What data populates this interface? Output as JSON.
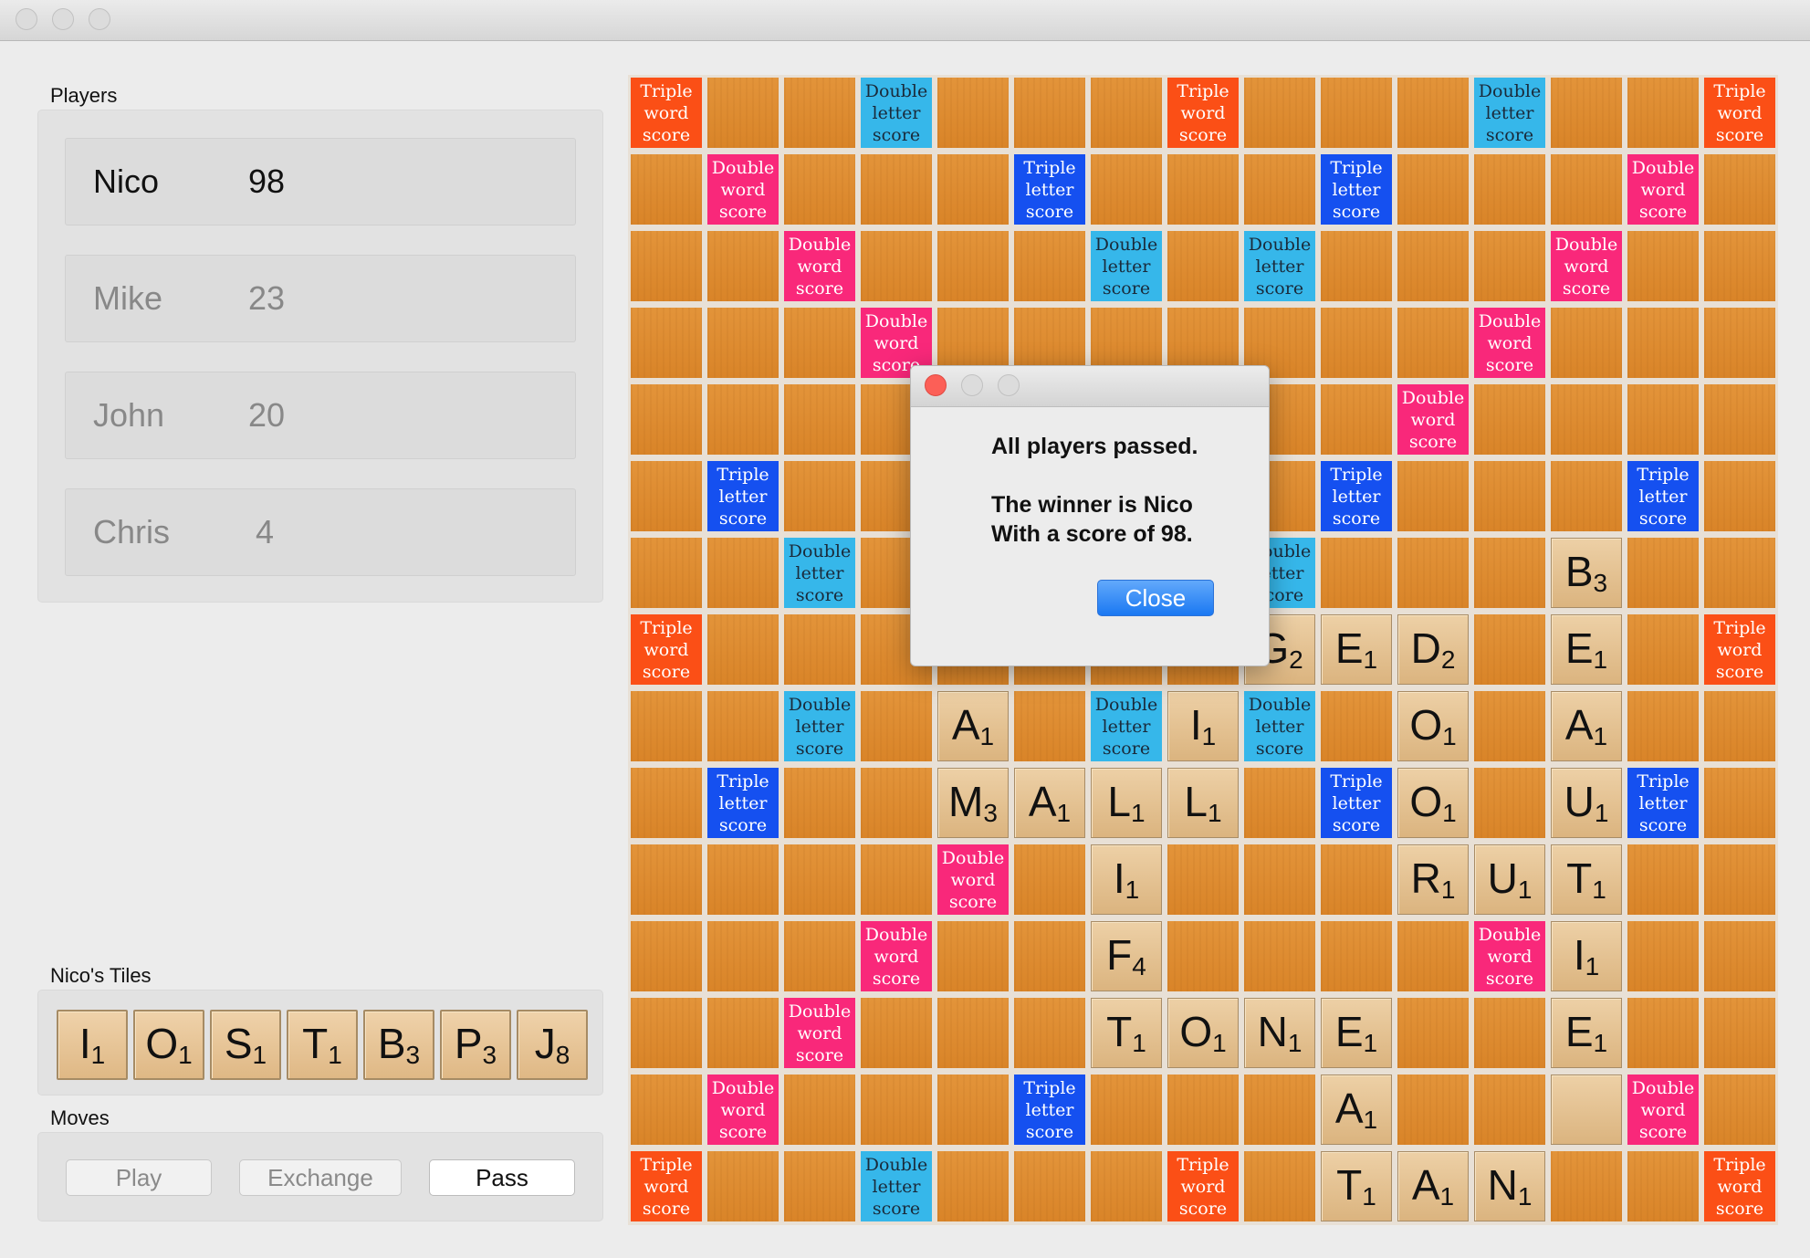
{
  "players_label": "Players",
  "players": [
    {
      "name": "Nico",
      "score": "98",
      "active": true
    },
    {
      "name": "Mike",
      "score": "23",
      "active": false
    },
    {
      "name": "John",
      "score": "20",
      "active": false
    },
    {
      "name": "Chris",
      "score": "4",
      "active": false
    }
  ],
  "rack_label": "Nico's Tiles",
  "rack": [
    {
      "letter": "I",
      "points": "1"
    },
    {
      "letter": "O",
      "points": "1"
    },
    {
      "letter": "S",
      "points": "1"
    },
    {
      "letter": "T",
      "points": "1"
    },
    {
      "letter": "B",
      "points": "3"
    },
    {
      "letter": "P",
      "points": "3"
    },
    {
      "letter": "J",
      "points": "8"
    }
  ],
  "moves_label": "Moves",
  "moves": {
    "play": "Play",
    "exchange": "Exchange",
    "pass": "Pass"
  },
  "bonus_labels": {
    "tw": "Triple\nword\nscore",
    "dw": "Double\nword\nscore",
    "tl": "Triple\nletter\nscore",
    "dl": "Double\nletter\nscore"
  },
  "board_rows": [
    "tw . . dl . . . tw . . . dl . . tw",
    ". dw . . . tl . . . tl . . . dw .",
    ". . dw . . . dl . dl . . . dw . .",
    ". . . dw . . . . . . . dw . . .",
    ". . . . . . . . . . dw . . . .",
    ". tl . . . . . . . tl . . . tl .",
    ". . dl . . . . . dl . . . B3 . .",
    "tw . . . . . . . G2 E1 D2 . E1 . tw",
    ". . dl . A1 . dl I1 dl . O1 . A1 . .",
    ". tl . . M3 A1 L1 L1 . tl O1 . U1 tl .",
    ". . . . dw . I1 . . . R1 U1 T1 . .",
    ". . . dw . . F4 . . . . dw I1 . .",
    ". . dw . . . T1 O1 N1 E1 . . E1 . .",
    ". dw . . . tl . . . A1 . . _ dw .",
    "tw . . dl . . . tw . T1 A1 N1 . . tw"
  ],
  "dialog": {
    "line1": "All players passed.",
    "line2": "The winner is Nico",
    "line3": "With a score of 98.",
    "close": "Close"
  },
  "colors": {
    "triple_word": "#fb4f16",
    "double_word": "#f9287a",
    "triple_letter": "#1550f0",
    "double_letter": "#36b7ea",
    "board_square": "#e08e32",
    "tile": "#e6c494",
    "close_button": "#1a78f2"
  }
}
